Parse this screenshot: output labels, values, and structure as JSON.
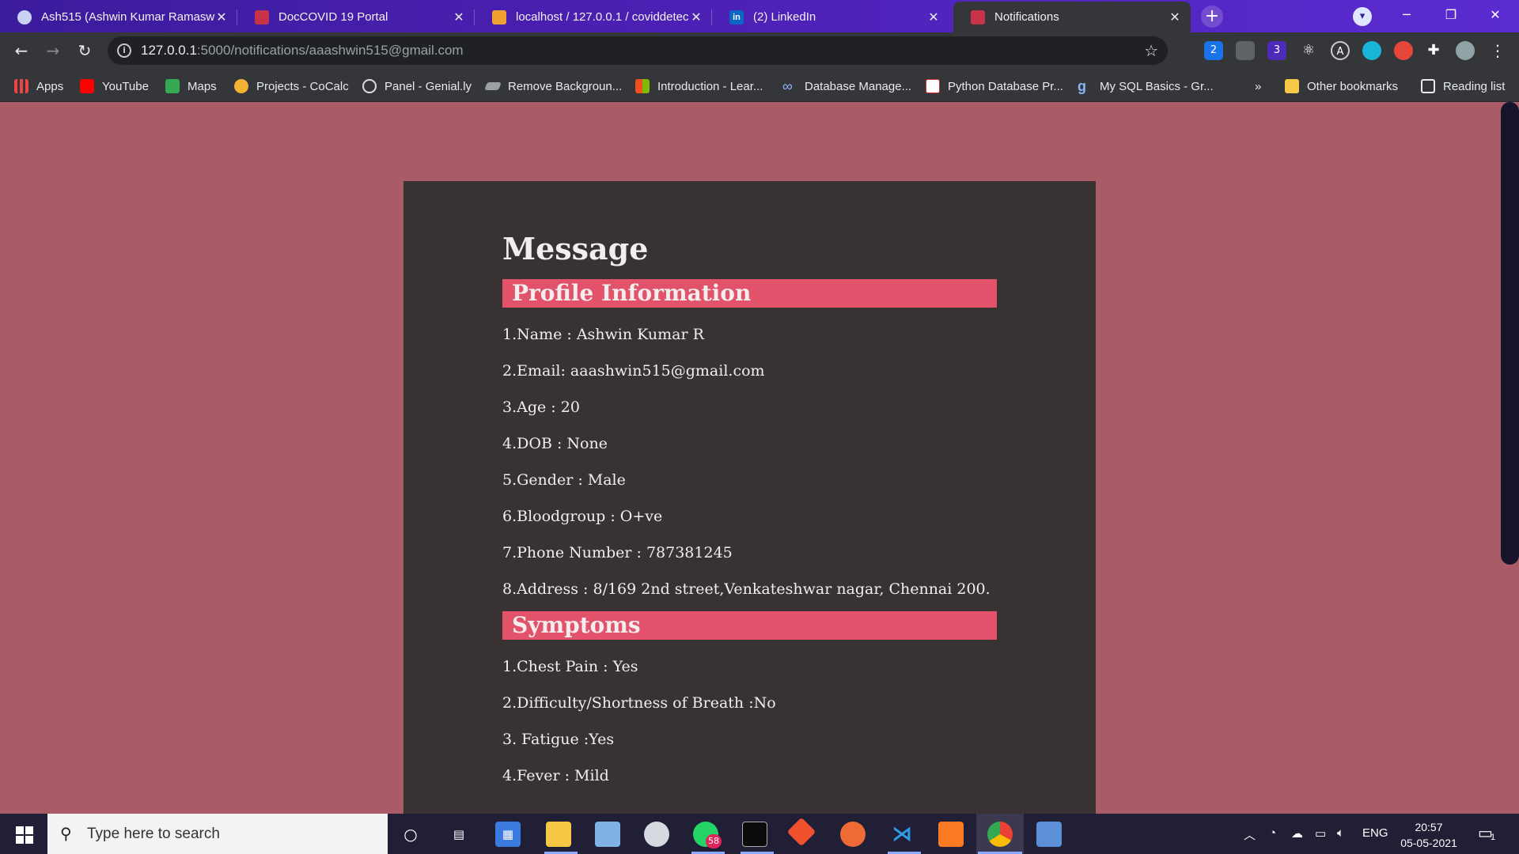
{
  "browser": {
    "tabs": [
      {
        "title": "Ash515 (Ashwin Kumar Ramaswa",
        "favicon": "github-icon"
      },
      {
        "title": "DocCOVID 19 Portal",
        "favicon": "covid-icon"
      },
      {
        "title": "localhost / 127.0.0.1 / coviddetec",
        "favicon": "phpmyadmin-icon"
      },
      {
        "title": "(2) LinkedIn",
        "favicon": "linkedin-icon"
      },
      {
        "title": "Notifications",
        "favicon": "covid-icon",
        "active": true
      }
    ],
    "url_host": "127.0.0.1",
    "url_rest": ":5000/notifications/aaashwin515@gmail.com",
    "extensions_badges": {
      "ext1": "2",
      "ext3": "3"
    },
    "bookmarks": [
      {
        "label": "Apps",
        "icon": "apps-grid-icon"
      },
      {
        "label": "YouTube",
        "icon": "youtube-icon"
      },
      {
        "label": "Maps",
        "icon": "maps-icon"
      },
      {
        "label": "Projects - CoCalc",
        "icon": "cocalc-icon"
      },
      {
        "label": "Panel - Genial.ly",
        "icon": "genially-icon"
      },
      {
        "label": "Remove Backgroun...",
        "icon": "removebg-icon"
      },
      {
        "label": "Introduction - Lear...",
        "icon": "microsoft-icon"
      },
      {
        "label": "Database Manage...",
        "icon": "infinity-icon"
      },
      {
        "label": "Python Database Pr...",
        "icon": "yn-icon"
      },
      {
        "label": "My SQL Basics - Gr...",
        "icon": "gfg-icon"
      }
    ],
    "bookmarks_overflow": "»",
    "other_bookmarks": "Other bookmarks",
    "reading_list": "Reading list"
  },
  "page": {
    "heading": "Message",
    "profile_section": "Profile Information",
    "profile_lines": [
      "1.Name : Ashwin Kumar R",
      "2.Email: aaashwin515@gmail.com",
      "3.Age : 20",
      "4.DOB : None",
      "5.Gender : Male",
      "6.Bloodgroup : O+ve",
      "7.Phone Number : 787381245",
      "8.Address : 8/169 2nd street,Venkateshwar nagar, Chennai 200."
    ],
    "symptoms_section": "Symptoms",
    "symptom_lines": [
      "1.Chest Pain : Yes",
      "2.Difficulty/Shortness of Breath :No",
      "3. Fatigue :Yes",
      "4.Fever : Mild"
    ]
  },
  "taskbar": {
    "search_placeholder": "Type here to search",
    "whatsapp_badge": "58",
    "language": "ENG",
    "time": "20:57",
    "date": "05-05-2021",
    "notification_count": "1"
  },
  "colors": {
    "page_background": "#a95c68",
    "card_background": "#393232",
    "section_bar": "#e2526a"
  }
}
